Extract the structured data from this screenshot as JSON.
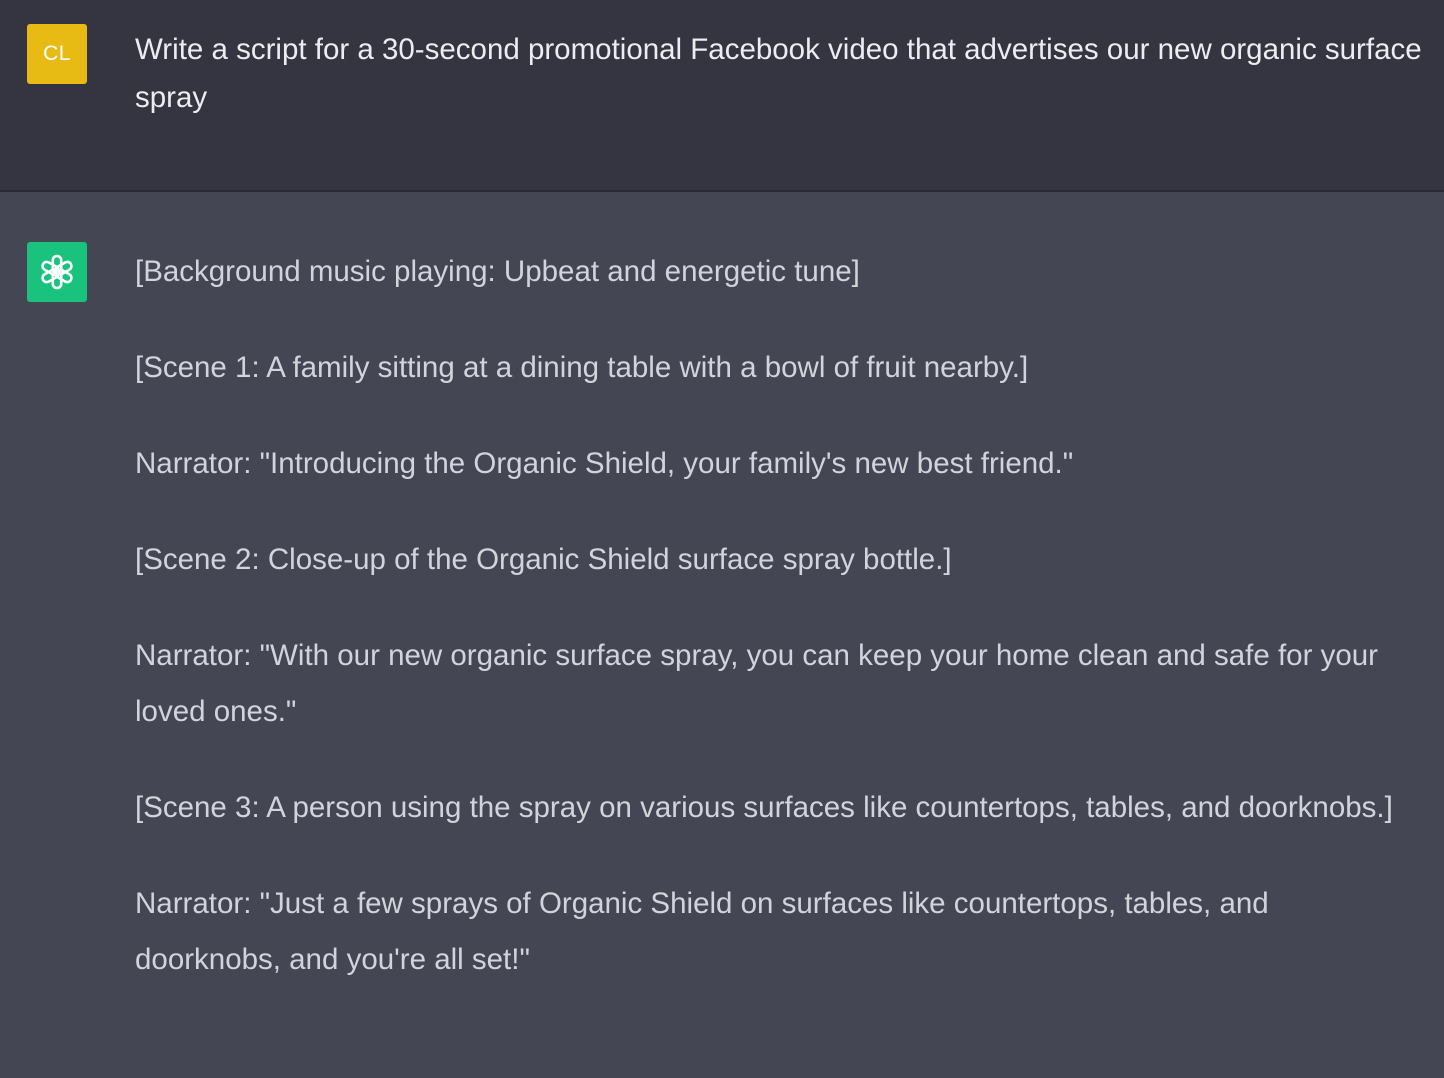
{
  "conversation": {
    "user_message": {
      "avatar_initials": "CL",
      "avatar_color": "#e7bb13",
      "text": "Write a script for a 30-second promotional Facebook video that advertises our new organic surface spray"
    },
    "assistant_message": {
      "avatar_icon": "openai-logo-icon",
      "avatar_color": "#19c37d",
      "paragraphs": [
        "[Background music playing: Upbeat and energetic tune]",
        "[Scene 1: A family sitting at a dining table with a bowl of fruit nearby.]",
        "Narrator: \"Introducing the Organic Shield, your family's new best friend.\"",
        "[Scene 2: Close-up of the Organic Shield surface spray bottle.]",
        "Narrator: \"With our new organic surface spray, you can keep your home clean and safe for your loved ones.\"",
        "[Scene 3: A person using the spray on various surfaces like countertops, tables, and doorknobs.]",
        "Narrator: \"Just a few sprays of Organic Shield on surfaces like countertops, tables, and doorknobs, and you're all set!\""
      ]
    }
  }
}
